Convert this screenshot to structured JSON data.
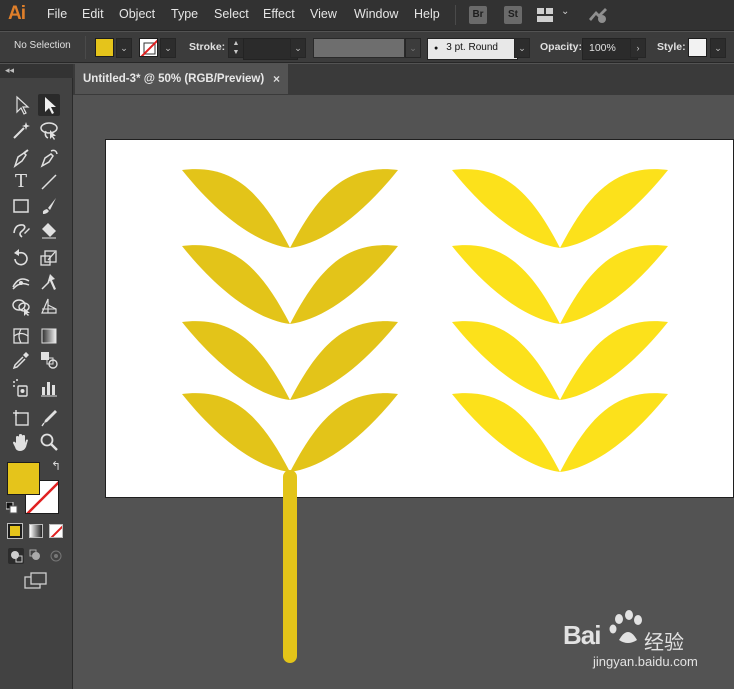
{
  "app": {
    "logo": "Ai",
    "logo_color": "#e07f2a"
  },
  "menu": [
    "File",
    "Edit",
    "Object",
    "Type",
    "Select",
    "Effect",
    "View",
    "Window",
    "Help"
  ],
  "menu_buttons": {
    "bridge": "Br",
    "stock": "St"
  },
  "control_bar": {
    "selection_label": "No Selection",
    "fill_color": "#e5c41b",
    "stroke_label": "Stroke:",
    "stroke_value": "",
    "brush_value": "3 pt. Round",
    "opacity_label": "Opacity:",
    "opacity_value": "100%",
    "style_label": "Style:"
  },
  "document_tab": {
    "title": "Untitled-3* @ 50% (RGB/Preview)",
    "close_glyph": "×"
  },
  "tools_panel": {
    "collapse_glyph": "◂◂"
  },
  "artwork": {
    "left_wheat_color": "#e3c419",
    "right_wheat_color": "#fce11b",
    "stem_color": "#e3c419"
  },
  "watermark": {
    "brand": "Bai",
    "brand_suffix": "经验",
    "url": "jingyan.baidu.com"
  }
}
